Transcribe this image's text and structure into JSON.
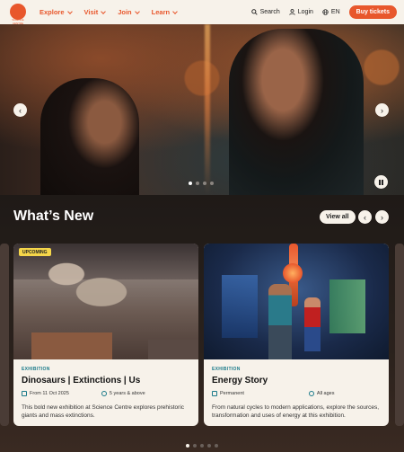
{
  "header": {
    "logo_text": "SCIENCE CENTRE",
    "nav": [
      {
        "label": "Explore"
      },
      {
        "label": "Visit"
      },
      {
        "label": "Join"
      },
      {
        "label": "Learn"
      }
    ],
    "search_label": "Search",
    "login_label": "Login",
    "language_label": "EN",
    "buy_label": "Buy tickets",
    "accent_color": "#e8572c"
  },
  "hero": {
    "prev_icon": "‹",
    "next_icon": "›",
    "slide_count": 4,
    "active_slide": 1
  },
  "whats_new": {
    "title": "What’s New",
    "view_all_label": "View all",
    "cards": [
      {
        "badge": "UPCOMING",
        "tag": "EXHIBITION",
        "title": "Dinosaurs | Extinctions | Us",
        "date": "From 11 Oct 2025",
        "age": "5 years & above",
        "description": "This bold new exhibition at Science Centre explores prehistoric giants and mass extinctions."
      },
      {
        "tag": "EXHIBITION",
        "title": "Energy Story",
        "date": "Permanent",
        "age": "All ages",
        "description": "From natural cycles to modern applications, explore the sources, transformation and uses of energy at this exhibition."
      }
    ],
    "page_count": 5,
    "active_page": 1
  }
}
